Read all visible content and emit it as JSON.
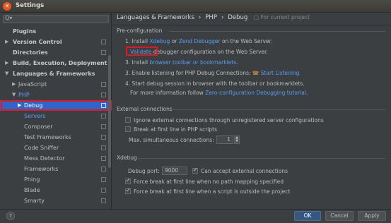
{
  "window": {
    "title": "Settings",
    "close_glyph": "✕"
  },
  "search": {
    "placeholder": "",
    "icon": "Q▾"
  },
  "sidebar": {
    "items": [
      {
        "label": "Plugins",
        "arrow": ""
      },
      {
        "label": "Version Control",
        "arrow": "▶"
      },
      {
        "label": "Directories",
        "arrow": ""
      },
      {
        "label": "Build, Execution, Deployment",
        "arrow": "▶"
      },
      {
        "label": "Languages & Frameworks",
        "arrow": "▼"
      },
      {
        "label": "JavaScript",
        "arrow": "▶"
      },
      {
        "label": "PHP",
        "arrow": "▼"
      },
      {
        "label": "Debug",
        "arrow": "▶"
      },
      {
        "label": "Servers",
        "arrow": ""
      },
      {
        "label": "Composer",
        "arrow": ""
      },
      {
        "label": "Test Frameworks",
        "arrow": ""
      },
      {
        "label": "Code Sniffer",
        "arrow": ""
      },
      {
        "label": "Mess Detector",
        "arrow": ""
      },
      {
        "label": "Frameworks",
        "arrow": ""
      },
      {
        "label": "Phing",
        "arrow": ""
      },
      {
        "label": "Blade",
        "arrow": ""
      },
      {
        "label": "Smarty",
        "arrow": ""
      }
    ]
  },
  "breadcrumb": {
    "part1": "Languages & Frameworks",
    "sep1": "›",
    "part2": "PHP",
    "sep2": "›",
    "part3": "Debug",
    "scope": "For current project"
  },
  "preconfig": {
    "title": "Pre-configuration",
    "step1_prefix": "1. Install",
    "step1_link1": "Xdebug",
    "step1_or": "or",
    "step1_link2": "Zend Debugger",
    "step1_suffix": "on the Web Server.",
    "step2_prefix": "2.",
    "step2_link": "Validate",
    "step2_suffix": "debugger configuration on the Web Server.",
    "step3_prefix": "3. Install",
    "step3_link": "browser toolbar or bookmarklets",
    "step3_suffix": ".",
    "step4_prefix": "3. Enable listening for PHP Debug Connections:",
    "step4_link": "Start Listening",
    "step5": "4. Start debug session in browser with the toolbar or bookmarklets.",
    "step6_prefix": "For more information follow",
    "step6_link": "Zero-configuration Debugging tutorial",
    "step6_suffix": "."
  },
  "external": {
    "title": "External connections",
    "ignore_label": "Ignore external connections through unregistered server configurations",
    "break_label": "Break at first line in PHP scripts",
    "max_label": "Max. simultaneous connections:",
    "max_value": "1"
  },
  "xdebug": {
    "title": "Xdebug",
    "port_label": "Debug port:",
    "port_value": "9000",
    "accept_label": "Can accept external connections",
    "force1_label": "Force break at first line when no path mapping specified",
    "force2_label": "Force break at first line when a script is outside the project"
  },
  "footer": {
    "help": "?",
    "ok": "OK",
    "cancel": "Cancel",
    "apply": "Apply"
  },
  "colors": {
    "accent": "#2f65ca",
    "link": "#589df6",
    "highlight": "#e8151c"
  }
}
